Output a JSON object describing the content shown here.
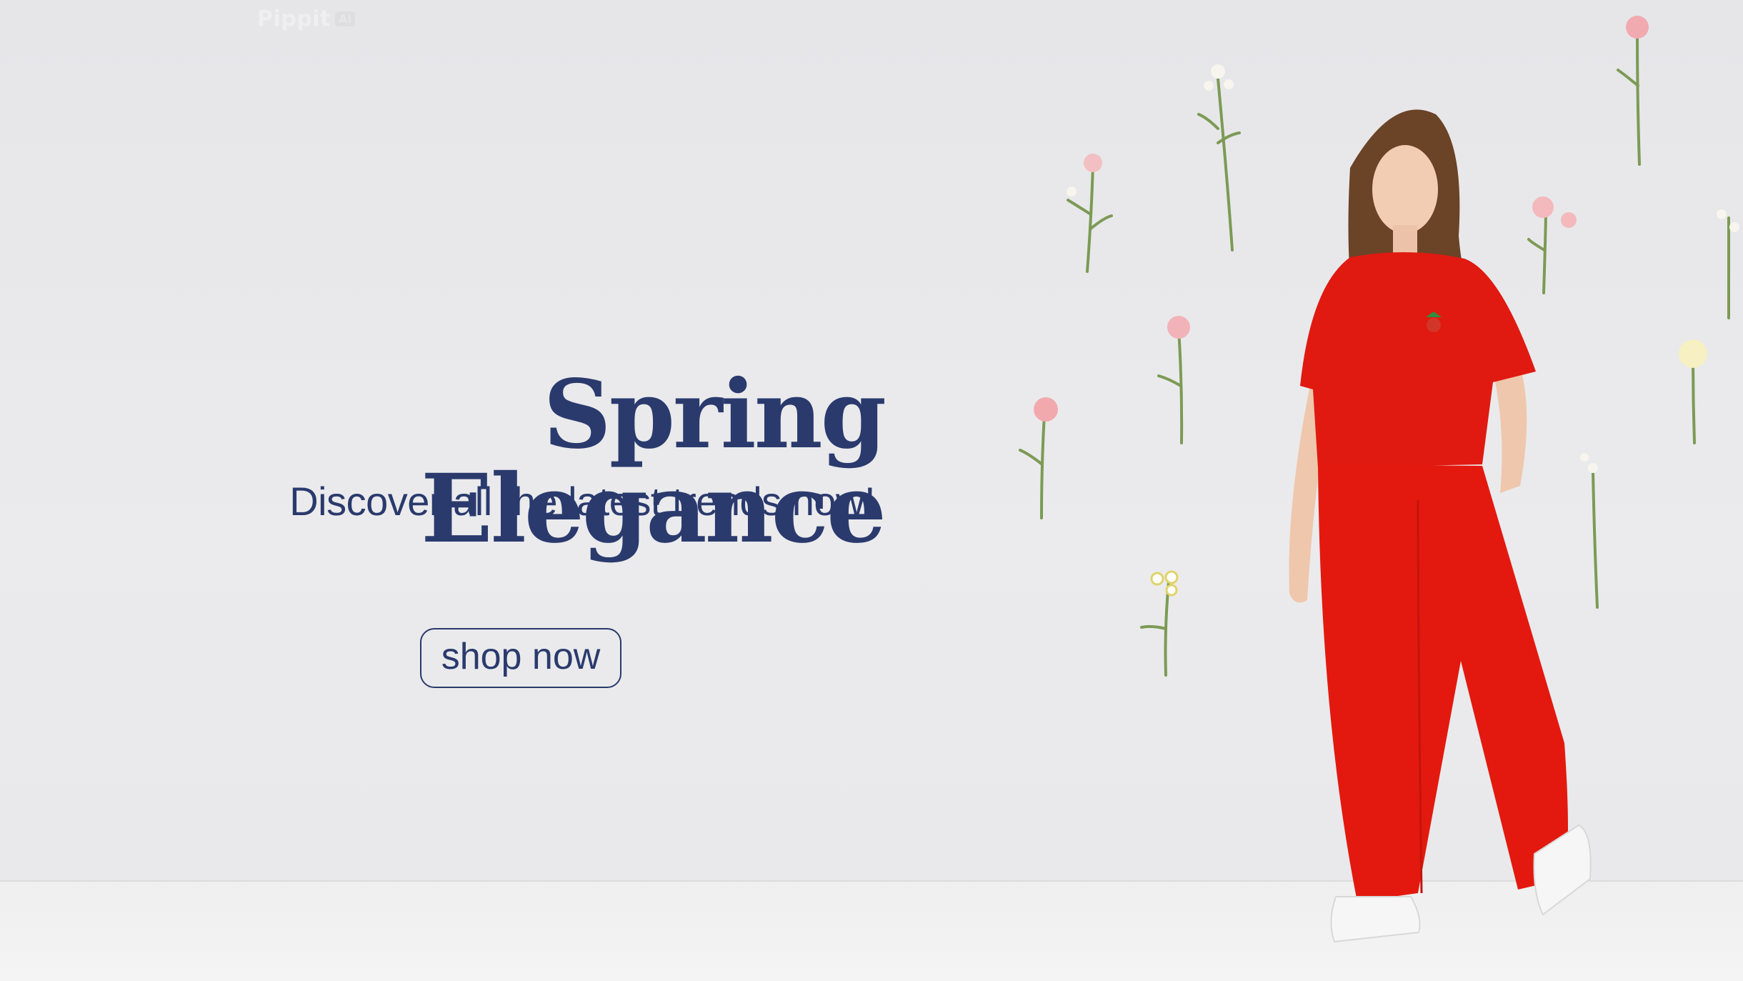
{
  "banner": {
    "watermark": {
      "text": "Pippit",
      "badge": "AI"
    },
    "headline": "Spring Elegance",
    "subtitle": "Discover all the latest trends now!",
    "cta_label": "shop now"
  },
  "colors": {
    "brand_navy": "#2a3a6d",
    "outfit_red": "#e01a10",
    "background": "#e9e9eb"
  }
}
